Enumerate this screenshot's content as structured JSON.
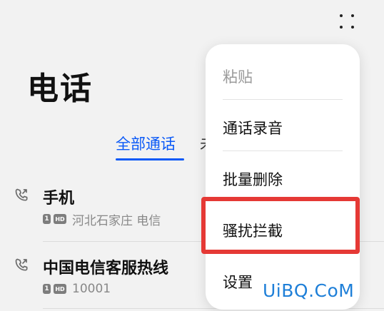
{
  "header": {
    "title": "电话"
  },
  "tabs": [
    {
      "label": "全部通话",
      "active": true
    },
    {
      "label": "未接来电",
      "active": false
    }
  ],
  "calls": [
    {
      "name": "手机",
      "sim_badge": "1",
      "hd_badge": "HD",
      "detail": "河北石家庄 电信"
    },
    {
      "name": "中国电信客服热线",
      "sim_badge": "1",
      "hd_badge": "HD",
      "detail": "10001"
    }
  ],
  "menu": {
    "items": [
      {
        "label": "粘贴",
        "enabled": false
      },
      {
        "label": "通话录音",
        "enabled": true
      },
      {
        "label": "批量删除",
        "enabled": true
      },
      {
        "label": "骚扰拦截",
        "enabled": true,
        "highlighted": true
      },
      {
        "label": "设置",
        "enabled": true
      }
    ]
  },
  "watermark": "UiBQ.CoM",
  "colors": {
    "accent": "#0a59f7",
    "highlight_box": "#e53935",
    "watermark": "#1e7fd8"
  },
  "icons": {
    "more": "more-vertical-dots-icon",
    "call_log": "outgoing-call-icon"
  }
}
